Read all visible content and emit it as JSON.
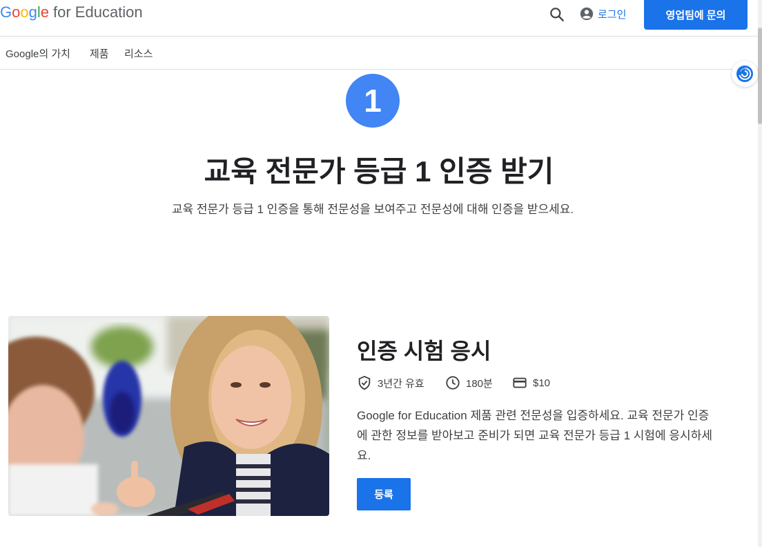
{
  "header": {
    "logo_letters": [
      "G",
      "o",
      "o",
      "g",
      "l",
      "e"
    ],
    "logo_rest": "for Education",
    "login_label": "로그인",
    "contact_label": "영업팀에 문의"
  },
  "nav": {
    "items": [
      "Google의 가치",
      "제품",
      "리소스"
    ]
  },
  "hero": {
    "step_number": "1",
    "title": "교육 전문가 등급 1 인증 받기",
    "subtitle": "교육 전문가 등급 1 인증을 통해 전문성을 보여주고 전문성에 대해 인증을 받으세요."
  },
  "exam": {
    "title": "인증 시험 응시",
    "validity": "3년간 유효",
    "duration": "180분",
    "price": "$10",
    "description": "Google for Education 제품 관련 전문성을 입증하세요. 교육 전문가 인증에 관한 정보를 받아보고 준비가 되면 교육 전문가 등급 1 시험에 응시하세요.",
    "register_label": "등록"
  },
  "colors": {
    "accent": "#1a73e8",
    "badge": "#4285f4"
  }
}
